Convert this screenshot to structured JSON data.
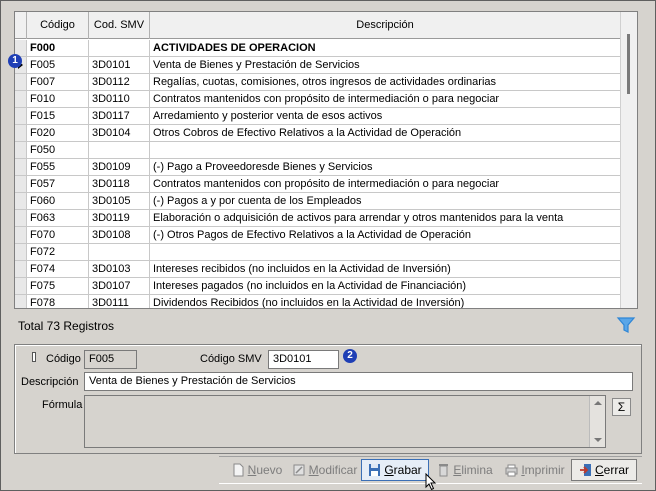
{
  "grid": {
    "columns": [
      "Código",
      "Cod. SMV",
      "Descripción"
    ],
    "rows": [
      {
        "codigo": "F000",
        "smv": "",
        "desc": "ACTIVIDADES DE OPERACION",
        "bold": true
      },
      {
        "codigo": "F005",
        "smv": "3D0101",
        "desc": "Venta de Bienes y Prestación de Servicios",
        "current": true
      },
      {
        "codigo": "F007",
        "smv": "3D0112",
        "desc": "Regalías, cuotas,  comisiones, otros ingresos de actividades ordinarias"
      },
      {
        "codigo": "F010",
        "smv": "3D0110",
        "desc": "Contratos mantenidos con propósito de intermediación o para negociar"
      },
      {
        "codigo": "F015",
        "smv": "3D0117",
        "desc": "Arredamiento y posterior venta de esos activos"
      },
      {
        "codigo": "F020",
        "smv": "3D0104",
        "desc": "Otros Cobros de Efectivo Relativos a la Actividad de Operación"
      },
      {
        "codigo": "F050",
        "smv": "",
        "desc": ""
      },
      {
        "codigo": "F055",
        "smv": "3D0109",
        "desc": "(-) Pago a Proveedoresde Bienes y Servicios"
      },
      {
        "codigo": "F057",
        "smv": "3D0118",
        "desc": "Contratos mantenidos con propósito de intermediación o para negociar"
      },
      {
        "codigo": "F060",
        "smv": "3D0105",
        "desc": "(-) Pagos a y por cuenta de los Empleados"
      },
      {
        "codigo": "F063",
        "smv": "3D0119",
        "desc": "Elaboración o adquisición de activos para arrendar y otros mantenidos para la venta"
      },
      {
        "codigo": "F070",
        "smv": "3D0108",
        "desc": "(-) Otros Pagos de Efectivo Relativos a la Actividad de Operación"
      },
      {
        "codigo": "F072",
        "smv": "",
        "desc": ""
      },
      {
        "codigo": "F074",
        "smv": "3D0103",
        "desc": "Intereses recibidos (no incluidos en la Actividad de Inversión)"
      },
      {
        "codigo": "F075",
        "smv": "3D0107",
        "desc": "Intereses pagados (no incluidos en la Actividad de Financiación)"
      },
      {
        "codigo": "F078",
        "smv": "3D0111",
        "desc": "Dividendos Recibidos (no incluidos en la Actividad de Inversión)"
      }
    ]
  },
  "badges": {
    "row": "1",
    "field": "2"
  },
  "total_label": "Total 73 Registros",
  "form": {
    "codigo_label": "Código",
    "codigo_value": "F005",
    "smv_label": "Código SMV",
    "smv_value": "3D0101",
    "descripcion_label": "Descripción",
    "descripcion_value": "Venta de Bienes y Prestación de Servicios",
    "formula_label": "Fórmula",
    "formula_value": "",
    "sigma_label": "Σ"
  },
  "toolbar": {
    "nuevo": {
      "u": "N",
      "rest": "uevo"
    },
    "modificar": {
      "u": "M",
      "rest": "odificar"
    },
    "grabar": {
      "u": "G",
      "rest": "rabar"
    },
    "elimina": {
      "u": "E",
      "rest": "limina"
    },
    "imprimir": {
      "u": "I",
      "rest": "mprimir"
    },
    "cerrar": {
      "u": "C",
      "rest": "errar"
    }
  },
  "colors": {
    "accent": "#1f3fb5",
    "active_border": "#3b6fb6",
    "filter": "#2f86d6",
    "exit": "#c0392b"
  }
}
